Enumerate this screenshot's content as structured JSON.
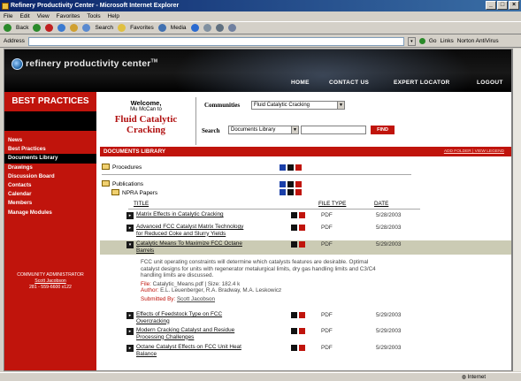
{
  "browser": {
    "title": "Refinery Productivity Center - Microsoft Internet Explorer",
    "menu": [
      "File",
      "Edit",
      "View",
      "Favorites",
      "Tools",
      "Help"
    ],
    "toolbar": {
      "back": "Back",
      "search": "Search",
      "favorites": "Favorites",
      "media": "Media"
    },
    "address_label": "Address",
    "go_label": "Go",
    "links_label": "Links",
    "norton_label": "Norton AntiVirus",
    "status_zone": "Internet"
  },
  "site": {
    "logo_text": "refinery productivity center",
    "logo_tm": "TM",
    "nav": [
      "HOME",
      "CONTACT US",
      "EXPERT LOCATOR",
      "LOGOUT"
    ]
  },
  "sidebar": {
    "title": "BEST PRACTICES",
    "items": [
      "News",
      "Best Practices",
      "Documents Library",
      "Drawings",
      "Discussion Board",
      "Contacts",
      "Calendar",
      "Members",
      "Manage Modules"
    ],
    "active": "Documents Library",
    "admin_label": "COMMUNITY ADMINISTRATOR",
    "admin_name": "Scott Jacobson",
    "admin_phone": "281 - 559-6600 x122"
  },
  "welcome": {
    "line1": "Welcome,",
    "line2": "Mu McCan to",
    "community_name_1": "Fluid Catalytic",
    "community_name_2": "Cracking"
  },
  "communities": {
    "label": "Communities",
    "selected": "Fluid Catalytic Cracking"
  },
  "search": {
    "label": "Search",
    "scope": "Documents Library",
    "find_label": "FIND"
  },
  "library": {
    "title": "DOCUMENTS LIBRARY",
    "links": "ADD FOLDER | VIEW LEGEND",
    "folders": [
      "Procedures",
      "Publications",
      "NPRA Papers"
    ],
    "columns": {
      "title": "TITLE",
      "file_type": "FILE TYPE",
      "date": "DATE"
    },
    "documents": [
      {
        "title": "Matrix Effects in Catalytic Cracking",
        "type": "PDF",
        "date": "5/28/2003"
      },
      {
        "title": "Advanced FCC Catalyst Matrix Technology for Reduced Coke and Slurry Yields",
        "type": "PDF",
        "date": "5/28/2003"
      },
      {
        "title": "Catalytic Means To Maximize FCC Octane Barrels",
        "type": "PDF",
        "date": "5/29/2003"
      },
      {
        "title": "Effects of Feedstock Type on FCC Overcracking",
        "type": "PDF",
        "date": "5/29/2003"
      },
      {
        "title": "Modern Cracking Catalyst and Residue Processing Challenges",
        "type": "PDF",
        "date": "5/29/2003"
      },
      {
        "title": "Octane Catalyst Effects on FCC Unit Heat Balance",
        "type": "PDF",
        "date": "5/29/2003"
      }
    ],
    "detail": {
      "description": "FCC unit operating constraints will determine which catalysts features are desirable. Optimal catalyst designs for units with regenerator metalurgical limits, dry gas handling limits and C3/C4 handling limits are discussed.",
      "file_label": "File:",
      "file_value": "Catalytic_Means.pdf | Size: 182.4 k",
      "author_label": "Author:",
      "author_value": "E.L. Leuenberger, R.A. Bradway, M.A. Leskowicz",
      "submitted_label": "Submitted By:",
      "submitted_value": "Scott Jacobson"
    }
  }
}
